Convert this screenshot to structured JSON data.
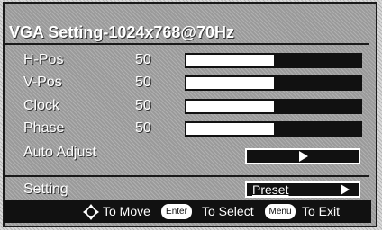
{
  "title": "VGA Setting-1024x768@70Hz",
  "rows": [
    {
      "label": "H-Pos",
      "value": "50",
      "level": 0.5
    },
    {
      "label": "V-Pos",
      "value": "50",
      "level": 0.5
    },
    {
      "label": "Clock",
      "value": "50",
      "level": 0.5
    },
    {
      "label": "Phase",
      "value": "50",
      "level": 0.5
    }
  ],
  "auto_adjust": {
    "label": "Auto Adjust"
  },
  "setting": {
    "label": "Setting",
    "option": "Preset"
  },
  "footer": {
    "move": "To Move",
    "enter_key": "Enter",
    "select": "To Select",
    "menu_key": "Menu",
    "exit": "To Exit"
  },
  "colors": {
    "bar_fill": "#111111",
    "bar_empty": "#ffffff",
    "text": "#ffffff"
  }
}
